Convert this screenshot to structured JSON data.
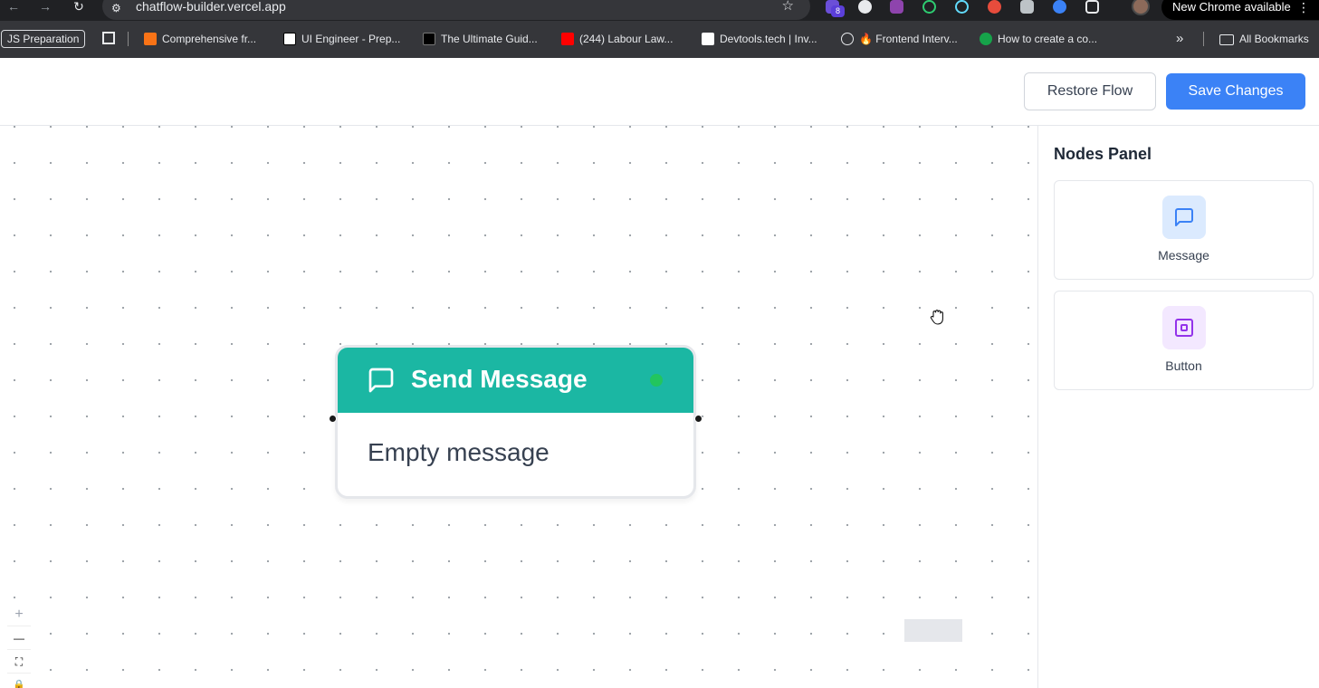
{
  "browser": {
    "url": "chatflow-builder.vercel.app",
    "ext_badge_count": "8",
    "update_label": "New Chrome available",
    "update_menu": "⋮"
  },
  "bookmarks": {
    "chip": "JS Preparation",
    "items": [
      "Comprehensive fr...",
      "UI Engineer - Prep...",
      "The Ultimate Guid...",
      "(244) Labour Law...",
      "Devtools.tech | Inv...",
      "🔥 Frontend Interv...",
      "How to create a co..."
    ],
    "overflow": "»",
    "all_bookmarks": "All Bookmarks"
  },
  "header": {
    "restore_label": "Restore Flow",
    "save_label": "Save Changes",
    "save_color": "#3b82f6"
  },
  "canvas": {
    "node": {
      "title": "Send Message",
      "body": "Empty message",
      "header_color": "#1bb7a3",
      "status_color": "#22c55e",
      "icon": "message-square-icon"
    },
    "controls": {
      "zoom_in": "+",
      "zoom_out": "—",
      "fit": "⛶",
      "lock": "🔒"
    }
  },
  "panel": {
    "title": "Nodes Panel",
    "items": [
      {
        "label": "Message",
        "icon": "message-square-icon",
        "color": "#3b82f6",
        "bg": "#dbeafe"
      },
      {
        "label": "Button",
        "icon": "button-square-icon",
        "color": "#9333ea",
        "bg": "#f3e8ff"
      }
    ]
  }
}
